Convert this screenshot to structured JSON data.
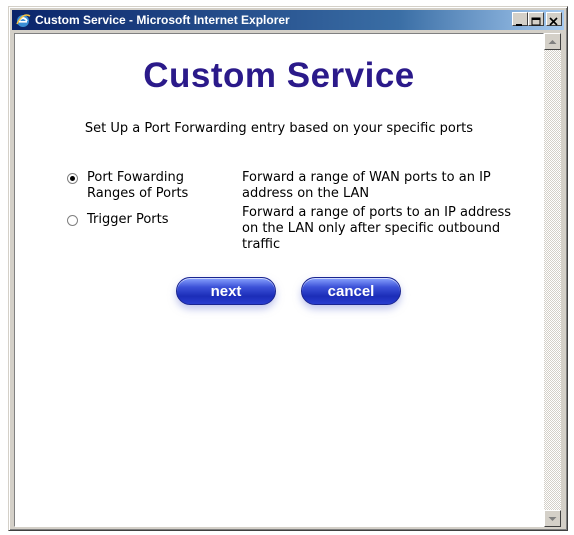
{
  "window": {
    "title": "Custom Service - Microsoft Internet Explorer"
  },
  "page": {
    "title": "Custom Service",
    "subtitle": "Set Up a Port Forwarding entry based on your specific ports"
  },
  "options": [
    {
      "label_line1": "Port Fowarding",
      "label_line2": "Ranges of Ports",
      "description": "Forward a range of WAN ports to an IP address on the LAN",
      "selected": true
    },
    {
      "label_line1": "Trigger Ports",
      "description": "Forward a range of ports to an IP address on the LAN only after specific outbound traffic",
      "selected": false
    }
  ],
  "buttons": {
    "next": "next",
    "cancel": "cancel"
  },
  "colors": {
    "title": "#2b1a8a",
    "button": "#1b2db8",
    "titlebar": "#0a246a"
  }
}
